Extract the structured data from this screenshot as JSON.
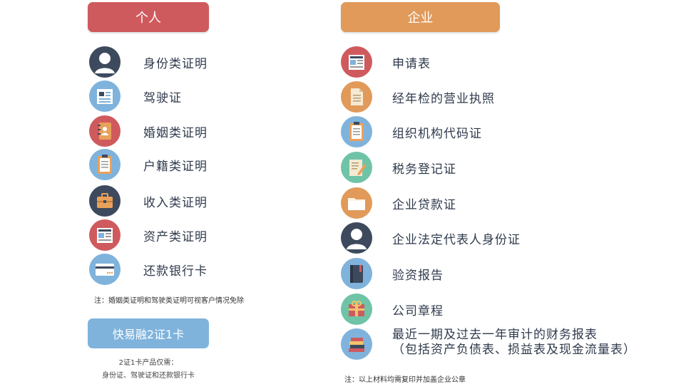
{
  "personal": {
    "title": "个人",
    "items": [
      {
        "label": "身份类证明",
        "icon": "person-icon",
        "color": "#3d4a5e"
      },
      {
        "label": "驾驶证",
        "icon": "id-card-icon",
        "color": "#7fb3dc"
      },
      {
        "label": "婚姻类证明",
        "icon": "address-book-icon",
        "color": "#cf5a5e"
      },
      {
        "label": "户籍类证明",
        "icon": "clipboard-icon",
        "color": "#7fb3dc"
      },
      {
        "label": "收入类证明",
        "icon": "briefcase-icon",
        "color": "#3d4a5e"
      },
      {
        "label": "资产类证明",
        "icon": "newspaper-icon",
        "color": "#cf5a5e"
      },
      {
        "label": "还款银行卡",
        "icon": "bank-card-icon",
        "color": "#7fb3dc"
      }
    ],
    "note": "注：婚姻类证明和驾驶类证明可视客户情况免除",
    "button_label": "快易融2证1卡",
    "sub_line1": "2证1卡产品仅需：",
    "sub_line2": "身份证、驾驶证和还款银行卡"
  },
  "company": {
    "title": "企业",
    "items": [
      {
        "label": "申请表",
        "icon": "newspaper-icon",
        "color": "#cf5a5e"
      },
      {
        "label": "经年检的营业执照",
        "icon": "document-icon",
        "color": "#e19a5a"
      },
      {
        "label": "组织机构代码证",
        "icon": "clipboard-icon",
        "color": "#7fb3dc"
      },
      {
        "label": "税务登记证",
        "icon": "edit-document-icon",
        "color": "#6fc3a6"
      },
      {
        "label": "企业贷款证",
        "icon": "folder-icon",
        "color": "#e19a5a"
      },
      {
        "label": "企业法定代表人身份证",
        "icon": "person-icon",
        "color": "#3d4a5e"
      },
      {
        "label": "验资报告",
        "icon": "notebook-icon",
        "color": "#7fb3dc"
      },
      {
        "label": "公司章程",
        "icon": "gift-box-icon",
        "color": "#6fc3a6"
      },
      {
        "label": "最近一期及过去一年审计的财务报表",
        "label2": "（包括资产负债表、损益表及现金流量表）",
        "icon": "books-icon",
        "color": "#7fb3dc"
      }
    ],
    "note": "注：以上材料均需复印并加盖企业公章"
  }
}
